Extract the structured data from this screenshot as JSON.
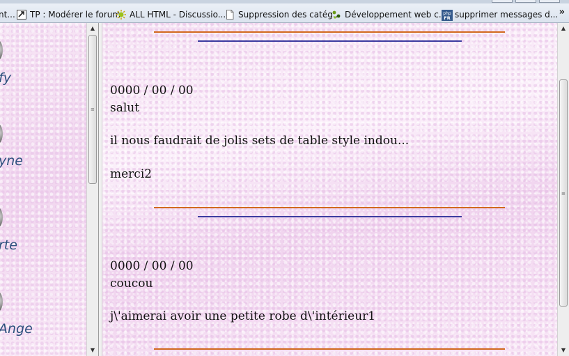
{
  "bookmarks": [
    {
      "label": "nt...",
      "icon": "page-icon"
    },
    {
      "label": "TP : Modérer le forum",
      "icon": "tp-logo-icon"
    },
    {
      "label": "ALL HTML - Discussio...",
      "icon": "sun-logo-icon"
    },
    {
      "label": "Suppression des catég...",
      "icon": "blank-page-icon"
    },
    {
      "label": "Développement web c...",
      "icon": "dots-logo-icon"
    },
    {
      "label": "supprimer messages d...",
      "icon": "phpfr-logo-icon"
    }
  ],
  "overflow_chevron": "»",
  "sidebar": {
    "members": [
      {
        "name": "fy"
      },
      {
        "name": "yne"
      },
      {
        "name": "rte"
      },
      {
        "name": "Ange"
      }
    ]
  },
  "posts": [
    {
      "date": "0000 / 00 / 00",
      "lines": [
        "salut",
        "il nous faudrait de jolis sets de table style indou...",
        "merci2"
      ]
    },
    {
      "date": "0000 / 00 / 00",
      "lines": [
        "coucou",
        "j\\'aimerai avoir une petite robe d\\'intérieur1"
      ]
    }
  ],
  "colors": {
    "separator_orange": "#d2691e",
    "separator_blue": "#3c3ca0",
    "member_name": "#2c4f7d"
  }
}
